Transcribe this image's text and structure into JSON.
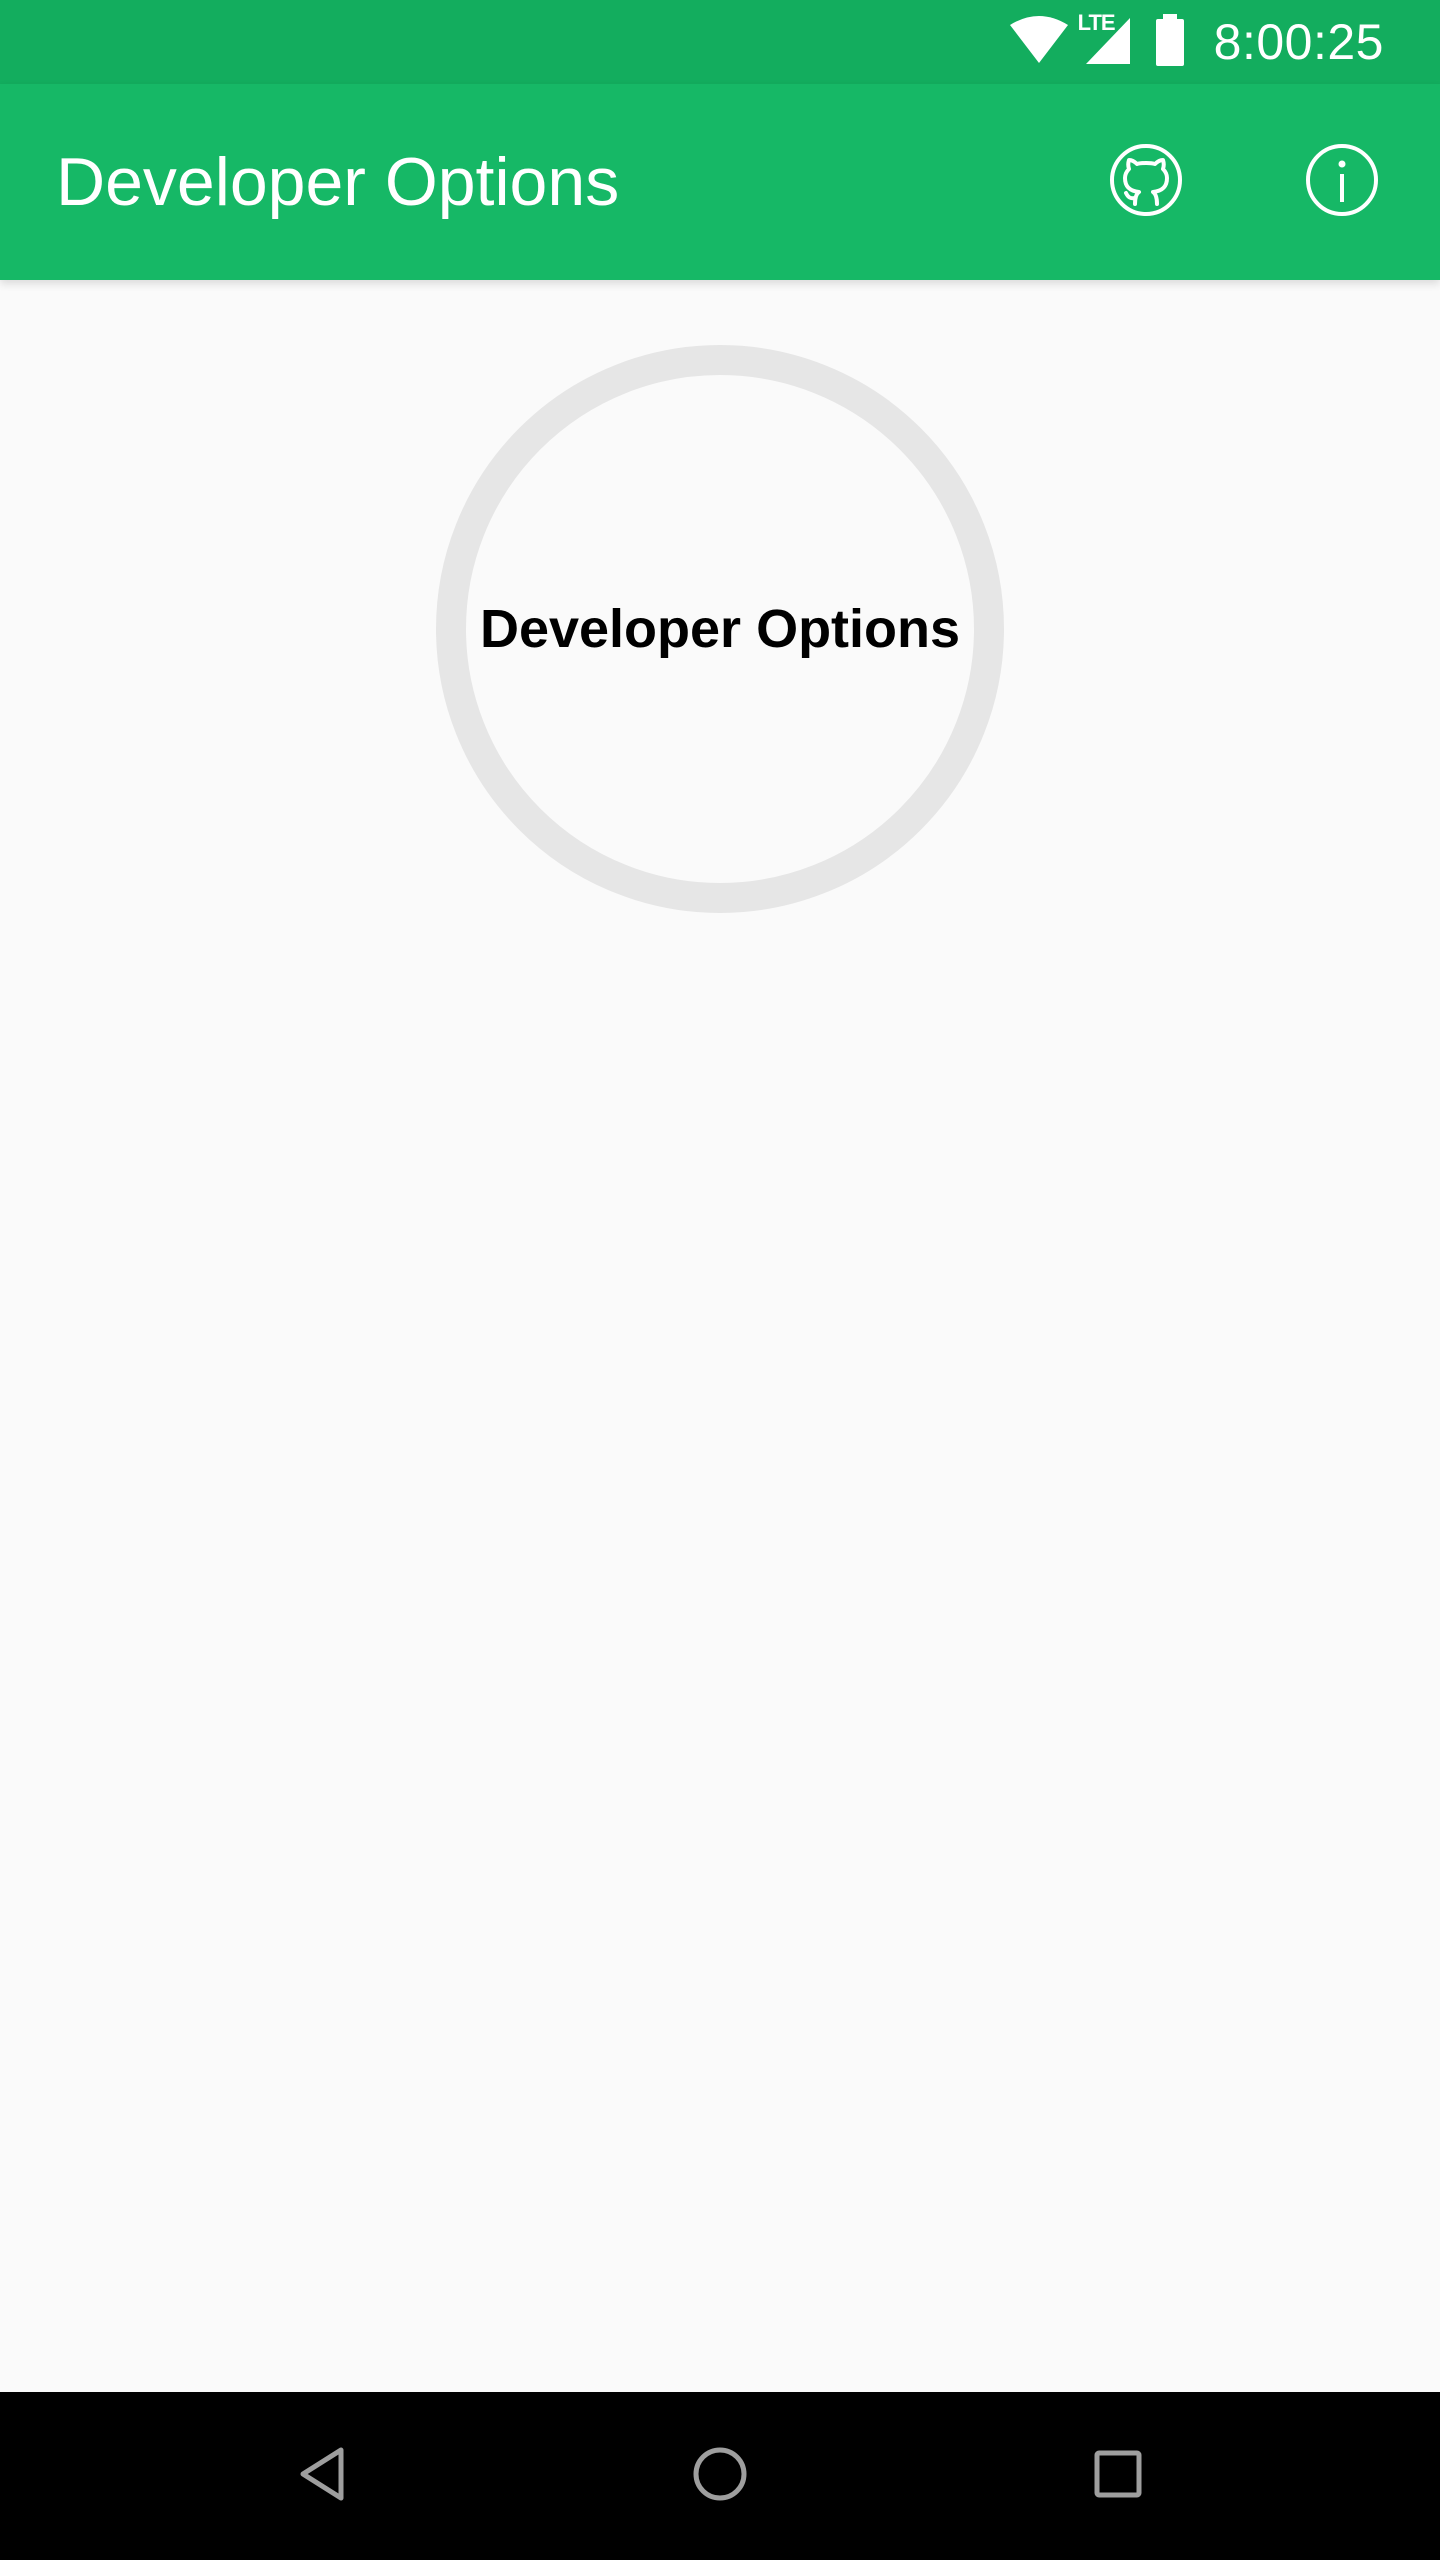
{
  "status_bar": {
    "time": "8:00:25",
    "network_label": "LTE",
    "icons": [
      "wifi-icon",
      "signal-icon",
      "battery-icon"
    ]
  },
  "app_bar": {
    "title": "Developer Options",
    "actions": [
      "github-icon",
      "info-icon"
    ]
  },
  "main": {
    "circle_button_label": "Developer Options"
  },
  "nav_bar": {
    "buttons": [
      "back-icon",
      "home-icon",
      "recents-icon"
    ]
  },
  "colors": {
    "status_bar": "#13ad5e",
    "app_bar": "#16b866",
    "background": "#fafafa",
    "circle_ring": "#e6e6e6",
    "nav_bar": "#000000"
  }
}
